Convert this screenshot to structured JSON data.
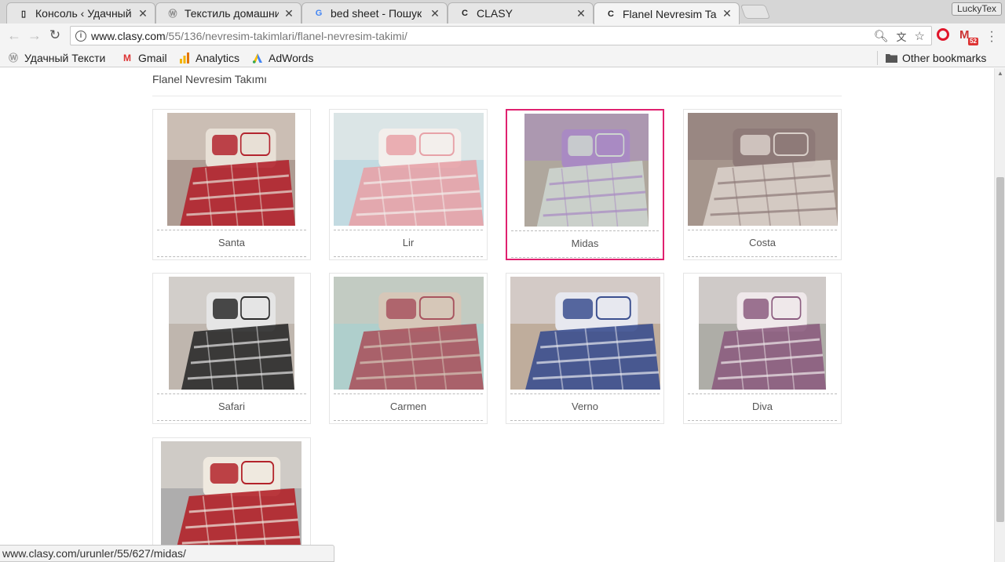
{
  "browser": {
    "tabs": [
      {
        "title": "Консоль ‹ Удачный",
        "favicon": "page-icon"
      },
      {
        "title": "Текстиль домашни",
        "favicon": "wordpress-icon"
      },
      {
        "title": "bed sheet - Пошук G",
        "favicon": "google-icon"
      },
      {
        "title": "CLASY",
        "favicon": "clasy-icon"
      },
      {
        "title": "Flanel Nevresim Tak",
        "favicon": "clasy-icon"
      }
    ],
    "profile_name": "LuckyTex",
    "url_host": "www.clasy.com",
    "url_path": "/55/136/nevresim-takimlari/flanel-nevresim-takimi/",
    "gmail_badge": "52",
    "bookmarks": [
      {
        "label": "Удачный Тексти",
        "icon": "wordpress-icon"
      },
      {
        "label": "Gmail",
        "icon": "gmail-icon"
      },
      {
        "label": "Analytics",
        "icon": "analytics-icon"
      },
      {
        "label": "AdWords",
        "icon": "adwords-icon"
      }
    ],
    "other_bookmarks": "Other bookmarks",
    "status_url": "www.clasy.com/urunler/55/627/midas/"
  },
  "page": {
    "section_title": "Flanel Nevresim Takımı",
    "products": [
      {
        "name": "Santa",
        "selected": false,
        "palette": [
          "#b3252f",
          "#e8e0d6",
          "#6b4a3a"
        ]
      },
      {
        "name": "Lir",
        "selected": false,
        "palette": [
          "#e7a2a8",
          "#f3efec",
          "#8fbcc8"
        ]
      },
      {
        "name": "Midas",
        "selected": true,
        "palette": [
          "#cdd5cf",
          "#a98ac3",
          "#6e5f4c"
        ]
      },
      {
        "name": "Costa",
        "selected": false,
        "palette": [
          "#d9cfc9",
          "#8e7a78",
          "#5b3e2e"
        ]
      },
      {
        "name": "Safari",
        "selected": false,
        "palette": [
          "#2b2b2b",
          "#e5e5e5",
          "#8a7a6b"
        ]
      },
      {
        "name": "Carmen",
        "selected": false,
        "palette": [
          "#a8545f",
          "#d6c7b8",
          "#6ea7a3"
        ]
      },
      {
        "name": "Verno",
        "selected": false,
        "palette": [
          "#3b4f8f",
          "#e7e8ef",
          "#8a6a4a"
        ]
      },
      {
        "name": "Diva",
        "selected": false,
        "palette": [
          "#8c5d80",
          "#efe8ea",
          "#6b6a5e"
        ]
      },
      {
        "name": "",
        "selected": false,
        "palette": [
          "#b3232a",
          "#efe9df",
          "#6b6a6a"
        ]
      }
    ]
  }
}
